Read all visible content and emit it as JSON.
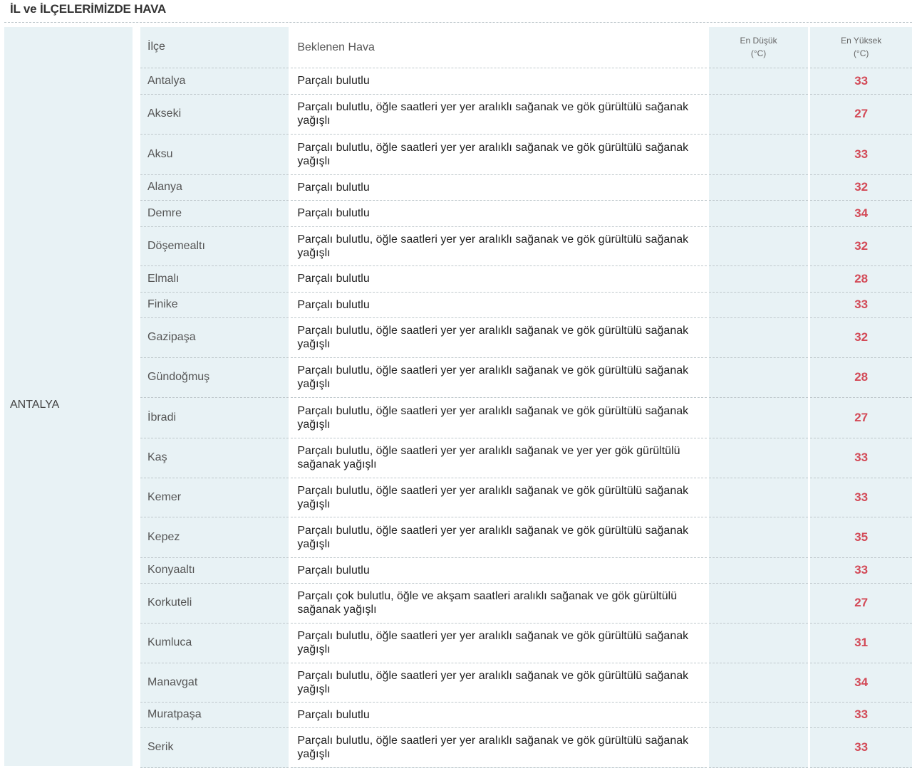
{
  "page": {
    "title": "İL ve İLÇELERİMİZDE HAVA",
    "province": "ANTALYA"
  },
  "table": {
    "headers": {
      "district": "İlçe",
      "forecast": "Beklenen Hava",
      "min_label": "En Düşük",
      "min_unit": "(°C)",
      "max_label": "En Yüksek",
      "max_unit": "(°C)"
    },
    "rows": [
      {
        "district": "Antalya",
        "forecast": "Parçalı bulutlu",
        "min": "",
        "max": "33"
      },
      {
        "district": "Akseki",
        "forecast": "Parçalı bulutlu, öğle saatleri yer yer aralıklı sağanak ve gök gürültülü sağanak yağışlı",
        "min": "",
        "max": "27"
      },
      {
        "district": "Aksu",
        "forecast": "Parçalı bulutlu, öğle saatleri yer yer aralıklı sağanak ve gök gürültülü sağanak yağışlı",
        "min": "",
        "max": "33"
      },
      {
        "district": "Alanya",
        "forecast": "Parçalı bulutlu",
        "min": "",
        "max": "32"
      },
      {
        "district": "Demre",
        "forecast": "Parçalı bulutlu",
        "min": "",
        "max": "34"
      },
      {
        "district": "Döşemealtı",
        "forecast": "Parçalı bulutlu, öğle saatleri yer yer aralıklı sağanak ve gök gürültülü sağanak yağışlı",
        "min": "",
        "max": "32"
      },
      {
        "district": "Elmalı",
        "forecast": "Parçalı bulutlu",
        "min": "",
        "max": "28"
      },
      {
        "district": "Finike",
        "forecast": "Parçalı bulutlu",
        "min": "",
        "max": "33"
      },
      {
        "district": "Gazipaşa",
        "forecast": "Parçalı bulutlu, öğle saatleri yer yer aralıklı sağanak ve gök gürültülü sağanak yağışlı",
        "min": "",
        "max": "32"
      },
      {
        "district": "Gündoğmuş",
        "forecast": "Parçalı bulutlu, öğle saatleri yer yer aralıklı sağanak ve gök gürültülü sağanak yağışlı",
        "min": "",
        "max": "28"
      },
      {
        "district": "İbradi",
        "forecast": "Parçalı bulutlu, öğle saatleri yer yer aralıklı sağanak ve gök gürültülü sağanak yağışlı",
        "min": "",
        "max": "27"
      },
      {
        "district": "Kaş",
        "forecast": "Parçalı bulutlu, öğle saatleri yer yer aralıklı sağanak ve yer yer gök gürültülü sağanak yağışlı",
        "min": "",
        "max": "33"
      },
      {
        "district": "Kemer",
        "forecast": "Parçalı bulutlu, öğle saatleri yer yer aralıklı sağanak ve gök gürültülü sağanak yağışlı",
        "min": "",
        "max": "33"
      },
      {
        "district": "Kepez",
        "forecast": "Parçalı bulutlu, öğle saatleri yer yer aralıklı sağanak ve gök gürültülü sağanak yağışlı",
        "min": "",
        "max": "35"
      },
      {
        "district": "Konyaaltı",
        "forecast": "Parçalı bulutlu",
        "min": "",
        "max": "33"
      },
      {
        "district": "Korkuteli",
        "forecast": "Parçalı çok bulutlu, öğle ve akşam saatleri aralıklı sağanak ve gök gürültülü sağanak yağışlı",
        "min": "",
        "max": "27"
      },
      {
        "district": "Kumluca",
        "forecast": "Parçalı bulutlu, öğle saatleri yer yer aralıklı sağanak ve gök gürültülü sağanak yağışlı",
        "min": "",
        "max": "31"
      },
      {
        "district": "Manavgat",
        "forecast": "Parçalı bulutlu, öğle saatleri yer yer aralıklı sağanak ve gök gürültülü sağanak yağışlı",
        "min": "",
        "max": "34"
      },
      {
        "district": "Muratpaşa",
        "forecast": "Parçalı bulutlu",
        "min": "",
        "max": "33"
      },
      {
        "district": "Serik",
        "forecast": "Parçalı bulutlu, öğle saatleri yer yer aralıklı sağanak ve gök gürültülü sağanak yağışlı",
        "min": "",
        "max": "33"
      }
    ]
  },
  "colors": {
    "max_temp": "#d34a57",
    "row_background": "#e8f2f5",
    "forecast_background": "#ffffff"
  }
}
